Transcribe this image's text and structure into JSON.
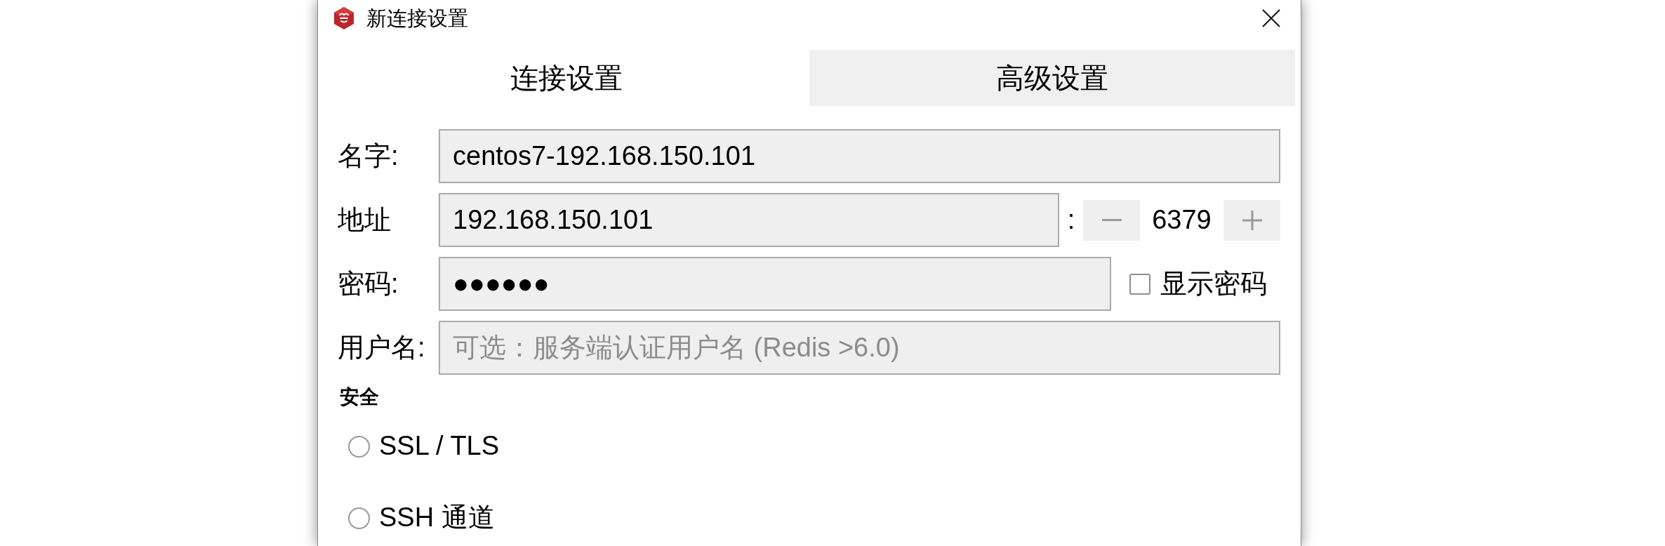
{
  "window": {
    "title": "新连接设置"
  },
  "tabs": [
    {
      "label": "连接设置",
      "selected": true
    },
    {
      "label": "高级设置",
      "selected": false
    }
  ],
  "fields": [
    {
      "kind": "text",
      "label": "名字:",
      "value": "centos7-192.168.150.101"
    },
    {
      "kind": "address",
      "label": "地址",
      "value": "192.168.150.101",
      "separator": ":",
      "port": "6379"
    },
    {
      "kind": "password",
      "label": "密码:",
      "value": "●●●●●●",
      "show_password": {
        "label": "显示密码",
        "checked": false
      }
    },
    {
      "kind": "text",
      "label": "用户名:",
      "placeholder": "可选：服务端认证用户名 (Redis >6.0)"
    }
  ],
  "security": {
    "title": "安全",
    "options": [
      {
        "label": "SSL / TLS",
        "selected": false
      },
      {
        "label": "SSH 通道",
        "selected": false
      }
    ]
  }
}
